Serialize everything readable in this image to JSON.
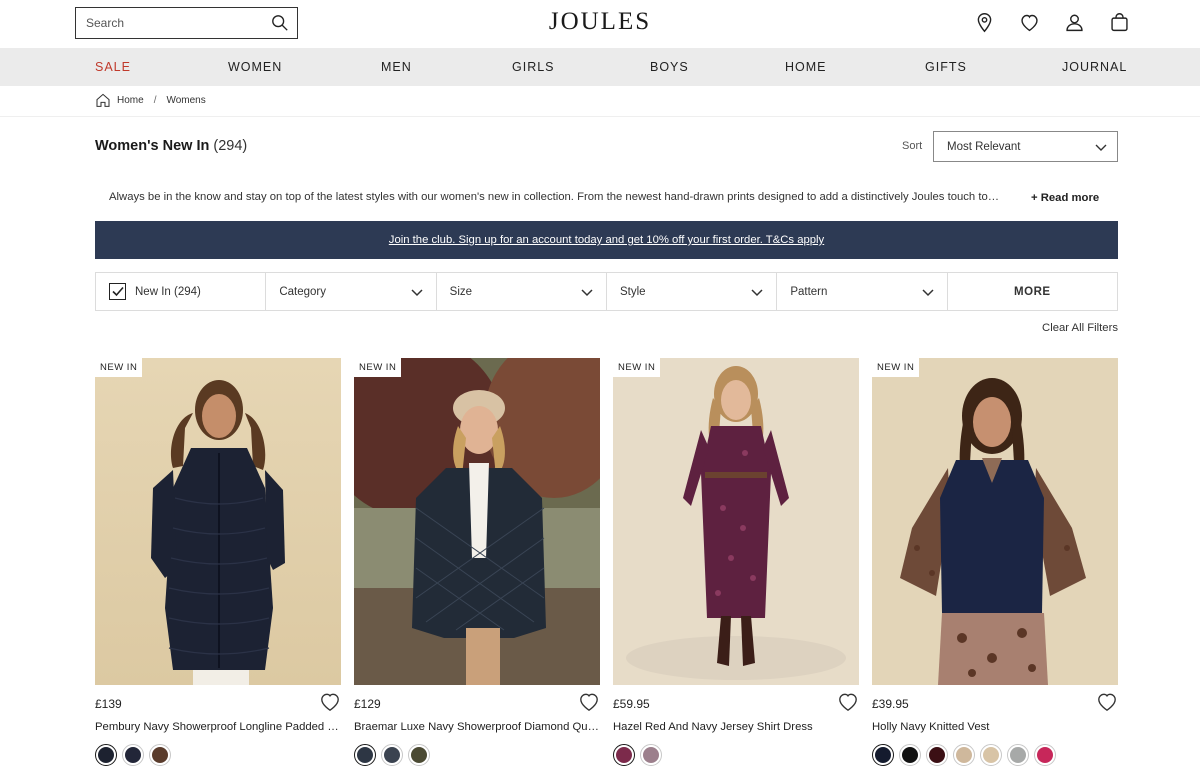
{
  "header": {
    "search_placeholder": "Search",
    "logo": "JOULES"
  },
  "nav": [
    "SALE",
    "WOMEN",
    "MEN",
    "GIRLS",
    "BOYS",
    "HOME",
    "GIFTS",
    "JOURNAL"
  ],
  "breadcrumb": {
    "home": "Home",
    "separator": "/",
    "current": "Womens"
  },
  "page": {
    "title": "Women's New In",
    "count": "(294)",
    "sort_label": "Sort",
    "sort_value": "Most Relevant",
    "intro": "Always be in the know and stay on top of the latest styles with our women's new in collection. From the newest hand-drawn prints designed to add a distinctively Joules touch to…",
    "read_more": "+ Read more"
  },
  "banner": {
    "text": "Join the club. Sign up for an account today and get 10% off your first order. T&Cs apply"
  },
  "filters": {
    "new_in": "New In (294)",
    "category": "Category",
    "size": "Size",
    "style": "Style",
    "pattern": "Pattern",
    "more": "MORE",
    "clear_all": "Clear All Filters"
  },
  "colors": {
    "sale": "#c0392b",
    "banner_bg": "#2d3a54",
    "nav_bg": "#ebebeb"
  },
  "products": [
    {
      "badge": "NEW IN",
      "price": "£139",
      "name": "Pembury Navy Showerproof Longline Padded Coat",
      "swatches": [
        "#1d2230",
        "#222638",
        "#5a3c2c"
      ]
    },
    {
      "badge": "NEW IN",
      "price": "£129",
      "name": "Braemar Luxe Navy Showerproof Diamond Quilted Jacket",
      "swatches": [
        "#2d3644",
        "#3b4350",
        "#4b4a33"
      ]
    },
    {
      "badge": "NEW IN",
      "price": "£59.95",
      "name": "Hazel Red And Navy Jersey Shirt Dress",
      "swatches": [
        "#7c2a4b",
        "#9c7f8c"
      ]
    },
    {
      "badge": "NEW IN",
      "price": "£39.95",
      "name": "Holly Navy Knitted Vest",
      "swatches": [
        "#141b2e",
        "#121212",
        "#3b0f14",
        "#cfb89c",
        "#d8c4a6",
        "#a7a9a8",
        "#c7275a"
      ]
    }
  ]
}
